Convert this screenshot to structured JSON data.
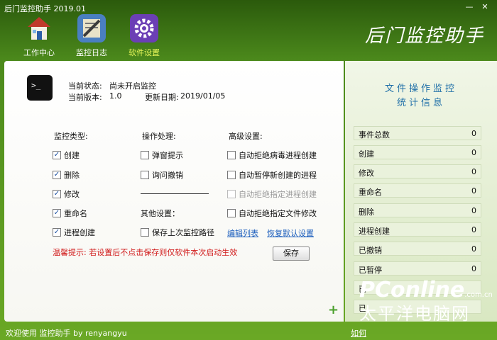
{
  "window": {
    "title": "后门监控助手 2019.01",
    "btn_min": "—",
    "btn_close": "✕"
  },
  "toolbar": [
    {
      "label": "工作中心",
      "icon": "house-icon"
    },
    {
      "label": "监控日志",
      "icon": "log-icon"
    },
    {
      "label": "软件设置",
      "icon": "gear-icon"
    }
  ],
  "brand": "后门监控助手",
  "info": {
    "status_label": "当前状态:",
    "status_value": "尚未开启监控",
    "version_label": "当前版本:",
    "version_value": "1.0",
    "update_label": "更新日期:",
    "update_value": "2019/01/05"
  },
  "columns": {
    "monitor_type": "监控类型:",
    "operation": "操作处理:",
    "advanced": "高级设置:",
    "other": "其他设置："
  },
  "monitor_types": [
    {
      "label": "创建",
      "checked": true
    },
    {
      "label": "删除",
      "checked": true
    },
    {
      "label": "修改",
      "checked": true
    },
    {
      "label": "重命名",
      "checked": true
    },
    {
      "label": "进程创建",
      "checked": true
    }
  ],
  "operations": [
    {
      "label": "弹窗提示",
      "checked": false
    },
    {
      "label": "询问撤销",
      "checked": false
    }
  ],
  "other_settings": [
    {
      "label": "保存上次监控路径",
      "checked": false
    }
  ],
  "advanced": [
    {
      "label": "自动拒绝病毒进程创建",
      "checked": false,
      "disabled": false
    },
    {
      "label": "自动暂停新创建的进程",
      "checked": false,
      "disabled": false
    },
    {
      "label": "自动拒绝指定进程创建",
      "checked": false,
      "disabled": true
    },
    {
      "label": "自动拒绝指定文件修改",
      "checked": false,
      "disabled": false
    }
  ],
  "links": {
    "edit_list": "编辑列表",
    "restore_default": "恢复默认设置"
  },
  "warning": "温馨提示: 若设置后不点击保存则仅软件本次启动生效",
  "save_button": "保存",
  "stats": {
    "title_line1": "文件操作监控",
    "title_line2": "统计信息",
    "rows": [
      {
        "label": "事件总数",
        "value": "0"
      },
      {
        "label": "创建",
        "value": "0"
      },
      {
        "label": "修改",
        "value": "0"
      },
      {
        "label": "重命名",
        "value": "0"
      },
      {
        "label": "删除",
        "value": "0"
      },
      {
        "label": "进程创建",
        "value": "0"
      },
      {
        "label": "已撤销",
        "value": "0"
      },
      {
        "label": "已暂停",
        "value": "0"
      },
      {
        "label": "已",
        "value": ""
      },
      {
        "label": "已",
        "value": ""
      }
    ]
  },
  "statusbar": {
    "left": "欢迎使用 监控助手  by  renyangyu",
    "right": "如何"
  },
  "watermark": {
    "brand": "PConline",
    "domain": ".com.cn",
    "cn": "太平洋电脑网"
  },
  "colors": {
    "accent": "#4c8a1c",
    "link": "#1d5fbd",
    "warning": "#d11a1a",
    "stats_title": "#1f6fa8"
  }
}
